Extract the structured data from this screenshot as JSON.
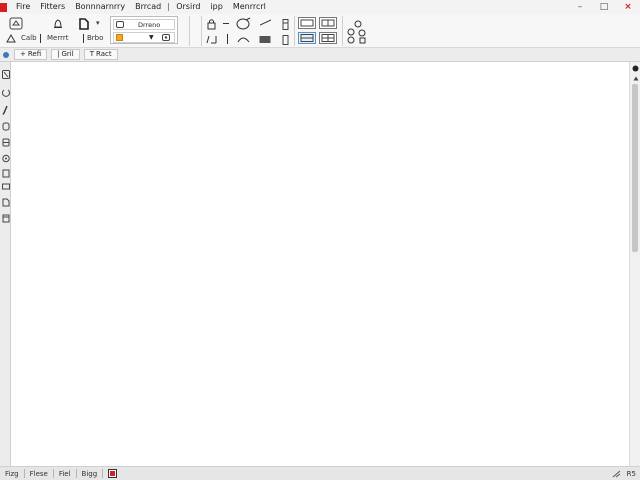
{
  "menu": {
    "items": [
      "Fire",
      "Fitters",
      "Bonnnarnrry",
      "Brrcad",
      "Orsird",
      "ipp",
      "Menrrcrl"
    ]
  },
  "window": {
    "minimize": "–",
    "maximize": "□",
    "close": "×"
  },
  "ribbon": {
    "group1": {
      "label_left": "Calb",
      "label_right": "Merrrt"
    },
    "group2": {
      "label": "Brbo",
      "dropdown_caret": "▾"
    },
    "style_box": {
      "row1_text": "Drreno",
      "row2_caret": "▾",
      "row2_symbol": "▼"
    },
    "accent_color": "#f5a623"
  },
  "tabs": [
    {
      "label": "Refi",
      "prefix": "+"
    },
    {
      "label": "Gril",
      "prefix": "|"
    },
    {
      "label": "Ract",
      "prefix": "T"
    }
  ],
  "status": {
    "items": [
      "Fizg",
      "Flese",
      "Fiel",
      "Bigg"
    ],
    "right": [
      "R5"
    ]
  }
}
